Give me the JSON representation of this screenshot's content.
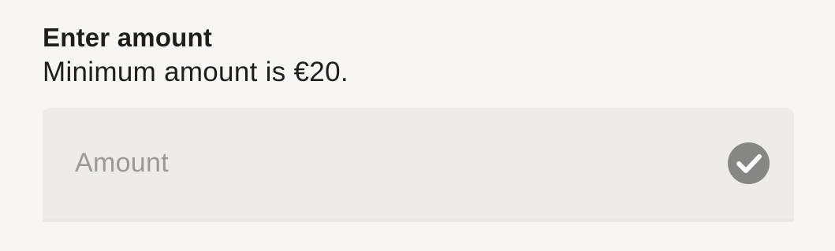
{
  "form": {
    "title": "Enter amount",
    "subtitle": "Minimum amount is €20.",
    "amount_field": {
      "placeholder": "Amount",
      "value": "",
      "status_icon": "checkmark-circle-icon"
    }
  },
  "colors": {
    "background": "#f7f6f3",
    "field_background": "#edecea",
    "text_primary": "#1f1e1c",
    "placeholder": "#9a9996",
    "check_icon_bg": "#868685"
  }
}
